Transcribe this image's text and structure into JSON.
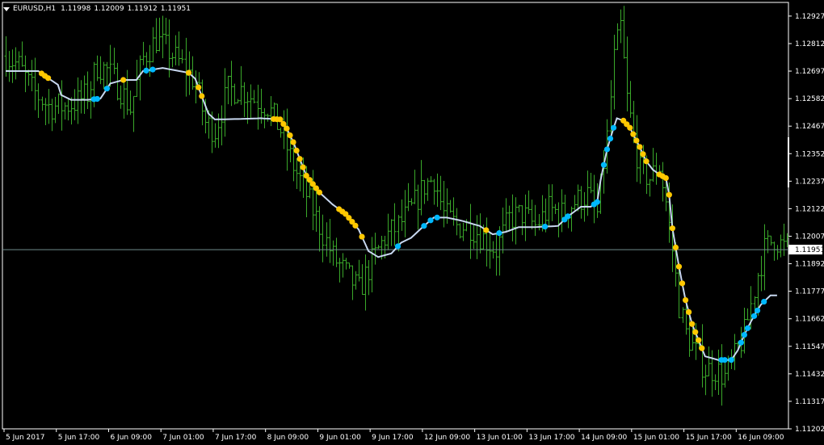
{
  "header": {
    "symbol": "EURUSD,H1",
    "open": "1.11998",
    "high": "1.12009",
    "low": "1.11912",
    "close": "1.11951"
  },
  "current_price": "1.11951",
  "colors": {
    "background": "#000000",
    "frame": "#ffffff",
    "bars": "#3aa82a",
    "line": "#c8d8f0",
    "dot_up": "#00b8ff",
    "dot_down": "#ffc800",
    "price_line": "#6f8c8c"
  },
  "chart_data": {
    "type": "ohlc",
    "symbol": "EURUSD",
    "timeframe": "H1",
    "ylim": [
      1.11202,
      1.12984
    ],
    "y_ticks": [
      "1.12927",
      "1.12812",
      "1.12697",
      "1.12582",
      "1.12467",
      "1.12352",
      "1.12237",
      "1.12122",
      "1.12007",
      "1.11892",
      "1.11777",
      "1.11662",
      "1.11547",
      "1.11432",
      "1.11317",
      "1.11202"
    ],
    "x_ticks": [
      "5 Jun 2017",
      "5 Jun 17:00",
      "6 Jun 09:00",
      "7 Jun 01:00",
      "7 Jun 17:00",
      "8 Jun 09:00",
      "9 Jun 01:00",
      "9 Jun 17:00",
      "12 Jun 09:00",
      "13 Jun 01:00",
      "13 Jun 17:00",
      "14 Jun 09:00",
      "15 Jun 01:00",
      "15 Jun 17:00",
      "16 Jun 09:00"
    ],
    "bars_count": 240,
    "price_anchors": [
      [
        0,
        1.1276
      ],
      [
        4,
        1.1272
      ],
      [
        8,
        1.1262
      ],
      [
        13,
        1.1255
      ],
      [
        18,
        1.1255
      ],
      [
        22,
        1.1257
      ],
      [
        25,
        1.126
      ],
      [
        28,
        1.1272
      ],
      [
        31,
        1.127
      ],
      [
        35,
        1.1262
      ],
      [
        38,
        1.1254
      ],
      [
        42,
        1.1275
      ],
      [
        46,
        1.1283
      ],
      [
        50,
        1.1278
      ],
      [
        54,
        1.1272
      ],
      [
        58,
        1.1265
      ],
      [
        61,
        1.1248
      ],
      [
        64,
        1.1245
      ],
      [
        68,
        1.1262
      ],
      [
        72,
        1.1262
      ],
      [
        76,
        1.1258
      ],
      [
        80,
        1.1255
      ],
      [
        84,
        1.1245
      ],
      [
        88,
        1.123
      ],
      [
        92,
        1.1218
      ],
      [
        96,
        1.1205
      ],
      [
        100,
        1.1192
      ],
      [
        104,
        1.1185
      ],
      [
        108,
        1.1178
      ],
      [
        112,
        1.119
      ],
      [
        116,
        1.12
      ],
      [
        120,
        1.1205
      ],
      [
        124,
        1.1212
      ],
      [
        128,
        1.1222
      ],
      [
        131,
        1.1225
      ],
      [
        134,
        1.121
      ],
      [
        138,
        1.1205
      ],
      [
        142,
        1.1205
      ],
      [
        146,
        1.12
      ],
      [
        150,
        1.1195
      ],
      [
        154,
        1.1208
      ],
      [
        158,
        1.121
      ],
      [
        162,
        1.1205
      ],
      [
        166,
        1.1212
      ],
      [
        170,
        1.121
      ],
      [
        174,
        1.1215
      ],
      [
        178,
        1.1218
      ],
      [
        181,
        1.121
      ],
      [
        184,
        1.1242
      ],
      [
        186,
        1.1275
      ],
      [
        188,
        1.1288
      ],
      [
        190,
        1.1258
      ],
      [
        192,
        1.1242
      ],
      [
        194,
        1.1228
      ],
      [
        197,
        1.1225
      ],
      [
        200,
        1.123
      ],
      [
        202,
        1.1215
      ],
      [
        204,
        1.1195
      ],
      [
        206,
        1.1172
      ],
      [
        208,
        1.116
      ],
      [
        211,
        1.1152
      ],
      [
        214,
        1.1145
      ],
      [
        217,
        1.1145
      ],
      [
        220,
        1.1142
      ],
      [
        223,
        1.115
      ],
      [
        226,
        1.116
      ],
      [
        228,
        1.1172
      ],
      [
        230,
        1.1185
      ],
      [
        232,
        1.1195
      ],
      [
        235,
        1.12
      ],
      [
        238,
        1.1196
      ]
    ],
    "series": [
      {
        "type": "line",
        "anchors": [
          [
            0,
            1.12697
          ],
          [
            10,
            1.12697
          ],
          [
            12,
            1.12677
          ],
          [
            16,
            1.1264
          ],
          [
            17,
            1.12597
          ],
          [
            20,
            1.12577
          ],
          [
            25,
            1.12577
          ],
          [
            29,
            1.12582
          ],
          [
            32,
            1.12645
          ],
          [
            36,
            1.1266
          ],
          [
            40,
            1.1266
          ],
          [
            42,
            1.12697
          ],
          [
            48,
            1.1271
          ],
          [
            52,
            1.127
          ],
          [
            56,
            1.1269
          ],
          [
            58,
            1.12665
          ],
          [
            62,
            1.1252
          ],
          [
            64,
            1.12495
          ],
          [
            72,
            1.12497
          ],
          [
            78,
            1.125
          ],
          [
            84,
            1.12495
          ],
          [
            86,
            1.12457
          ],
          [
            88,
            1.124
          ],
          [
            92,
            1.1226
          ],
          [
            96,
            1.1219
          ],
          [
            100,
            1.1214
          ],
          [
            104,
            1.121
          ],
          [
            108,
            1.12035
          ],
          [
            111,
            1.11945
          ],
          [
            114,
            1.1192
          ],
          [
            118,
            1.11935
          ],
          [
            121,
            1.1198
          ],
          [
            124,
            1.12
          ],
          [
            128,
            1.1205
          ],
          [
            131,
            1.12085
          ],
          [
            135,
            1.12085
          ],
          [
            140,
            1.1207
          ],
          [
            145,
            1.1205
          ],
          [
            149,
            1.12015
          ],
          [
            153,
            1.12025
          ],
          [
            157,
            1.12045
          ],
          [
            162,
            1.12045
          ],
          [
            169,
            1.1205
          ],
          [
            172,
            1.1209
          ],
          [
            176,
            1.1213
          ],
          [
            179,
            1.1213
          ],
          [
            181,
            1.1215
          ],
          [
            182,
            1.1224
          ],
          [
            184,
            1.1237
          ],
          [
            186,
            1.1246
          ],
          [
            187,
            1.125
          ],
          [
            189,
            1.1249
          ],
          [
            191,
            1.1246
          ],
          [
            194,
            1.1238
          ],
          [
            196,
            1.1232
          ],
          [
            198,
            1.12285
          ],
          [
            200,
            1.12265
          ],
          [
            202,
            1.1225
          ],
          [
            203,
            1.1218
          ],
          [
            204,
            1.1204
          ],
          [
            206,
            1.1188
          ],
          [
            208,
            1.1174
          ],
          [
            210,
            1.1164
          ],
          [
            214,
            1.11505
          ],
          [
            218,
            1.1149
          ],
          [
            222,
            1.1149
          ],
          [
            224,
            1.1153
          ],
          [
            226,
            1.11595
          ],
          [
            228,
            1.1165
          ],
          [
            231,
            1.1172
          ],
          [
            234,
            1.1176
          ],
          [
            236,
            1.1176
          ]
        ]
      }
    ],
    "up_dots": [
      27,
      28,
      31,
      43,
      45,
      120,
      128,
      130,
      132,
      151,
      165,
      171,
      172,
      180,
      181,
      183,
      184,
      185,
      186,
      219,
      220,
      222,
      225,
      226,
      227,
      229,
      230,
      232
    ],
    "down_dots": [
      11,
      12,
      13,
      36,
      56,
      59,
      60,
      82,
      83,
      84,
      85,
      86,
      87,
      88,
      89,
      90,
      91,
      92,
      93,
      94,
      95,
      96,
      102,
      103,
      104,
      105,
      106,
      107,
      109,
      147,
      189,
      190,
      191,
      192,
      193,
      194,
      195,
      196,
      200,
      201,
      202,
      203,
      204,
      205,
      206,
      207,
      208,
      209,
      210,
      211,
      212,
      213
    ],
    "grid": false,
    "legend": "none"
  }
}
